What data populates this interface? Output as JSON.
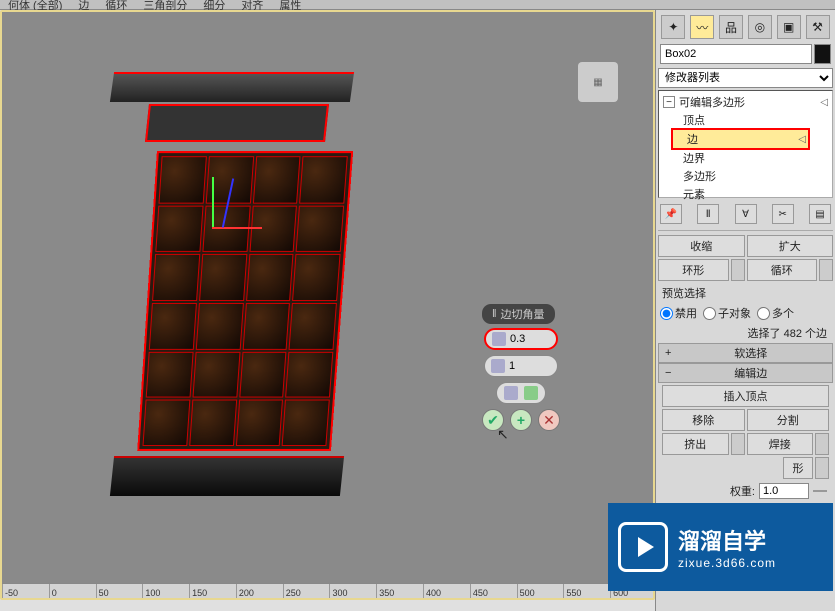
{
  "topTabs": [
    "何体 (全部)",
    "边",
    "循环",
    "三角剖分",
    "细分",
    "对齐",
    "属性"
  ],
  "objectName": "Box02",
  "modifierListLabel": "修改器列表",
  "stack": {
    "root": "可编辑多边形",
    "items": [
      "顶点",
      "边",
      "边界",
      "多边形",
      "元素"
    ],
    "selectedIndex": 1
  },
  "chamferTooltip": "边切角量",
  "chamferValue": "0.3",
  "segmentsValue": "1",
  "panel": {
    "shrink": "收缩",
    "grow": "扩大",
    "ring": "环形",
    "loop": "循环",
    "previewSel": "预览选择",
    "disable": "禁用",
    "subObj": "子对象",
    "multi": "多个",
    "selInfo": "选择了 482 个边",
    "softSel": "软选择",
    "editEdges": "编辑边",
    "insertVertex": "插入顶点",
    "remove": "移除",
    "split": "分割",
    "extrude": "挤出",
    "weld": "焊接",
    "shape": "形",
    "weight": "权重:",
    "weightValue": "1.0"
  },
  "rulerTicks": [
    "-50",
    "0",
    "50",
    "100",
    "150",
    "200",
    "250",
    "300",
    "350",
    "400",
    "450",
    "500",
    "550",
    "600"
  ],
  "watermark": {
    "main": "溜溜自学",
    "sub": "zixue.3d66.com"
  }
}
